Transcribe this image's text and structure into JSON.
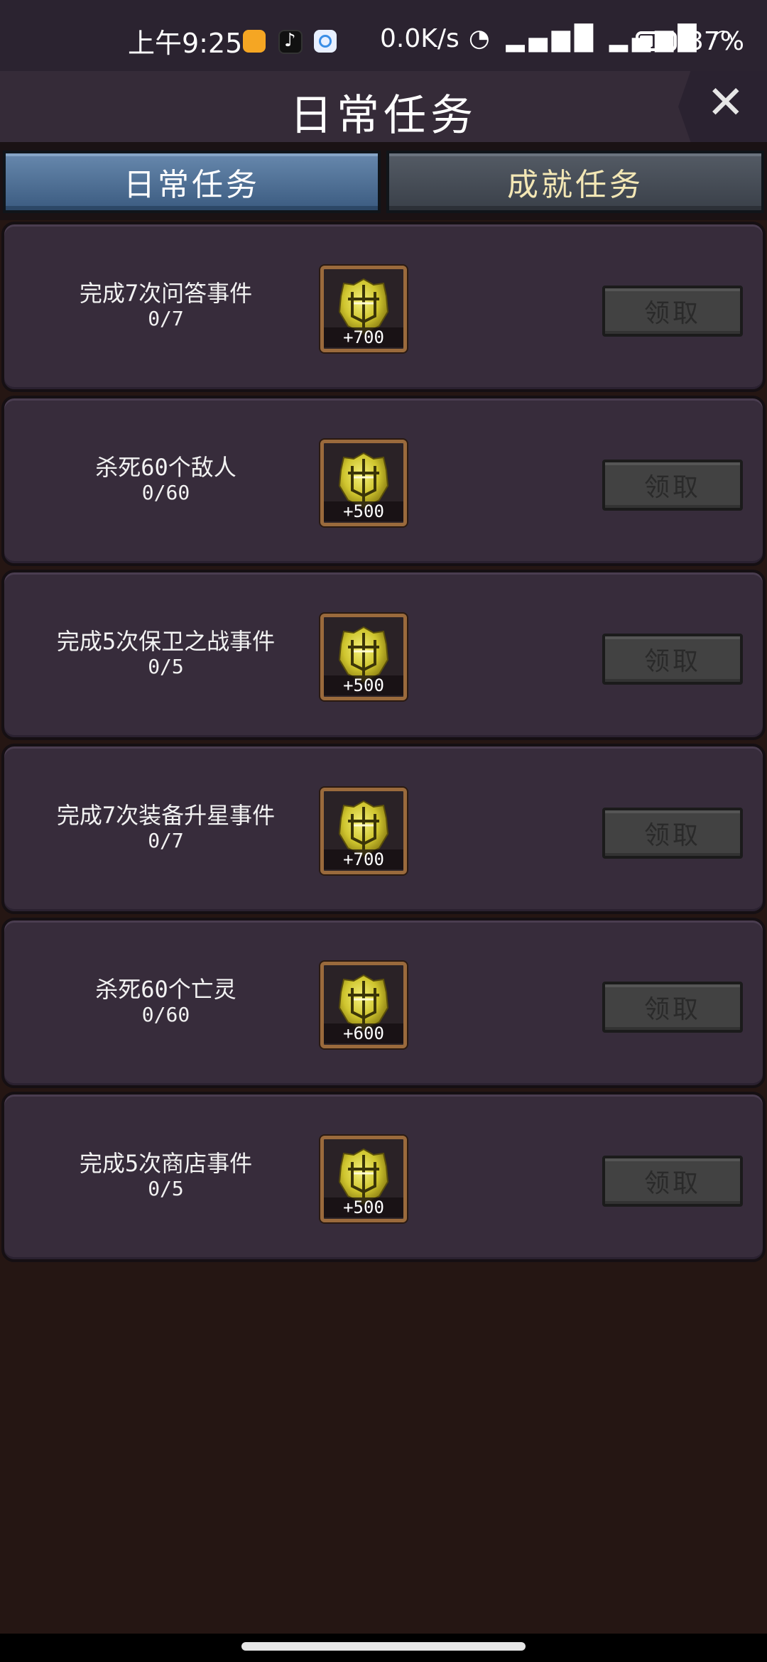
{
  "status_bar": {
    "time": "上午9:25",
    "net_speed": "0.0K/s",
    "signal": "◔ ▂▄▆█ ▂▄▆█ ◠",
    "battery": "37%"
  },
  "header": {
    "title": "日常任务",
    "close_label": "✕"
  },
  "tabs": [
    {
      "label": "日常任务",
      "active": true
    },
    {
      "label": "成就任务",
      "active": false
    }
  ],
  "tasks": [
    {
      "title": "完成7次问答事件",
      "progress": "0/7",
      "reward": "+700",
      "button": "领取"
    },
    {
      "title": "杀死60个敌人",
      "progress": "0/60",
      "reward": "+500",
      "button": "领取"
    },
    {
      "title": "完成5次保卫之战事件",
      "progress": "0/5",
      "reward": "+500",
      "button": "领取"
    },
    {
      "title": "完成7次装备升星事件",
      "progress": "0/7",
      "reward": "+700",
      "button": "领取"
    },
    {
      "title": "杀死60个亡灵",
      "progress": "0/60",
      "reward": "+600",
      "button": "领取"
    },
    {
      "title": "完成5次商店事件",
      "progress": "0/5",
      "reward": "+500",
      "button": "领取"
    }
  ],
  "icons": {
    "reward": "gold-emblem-icon",
    "close": "close-icon"
  },
  "colors": {
    "active_tab": "#4f7096",
    "inactive_tab": "#474e57",
    "card_bg": "#372c3b",
    "page_bg": "#251613",
    "reward_gold": "#d8d03a"
  }
}
